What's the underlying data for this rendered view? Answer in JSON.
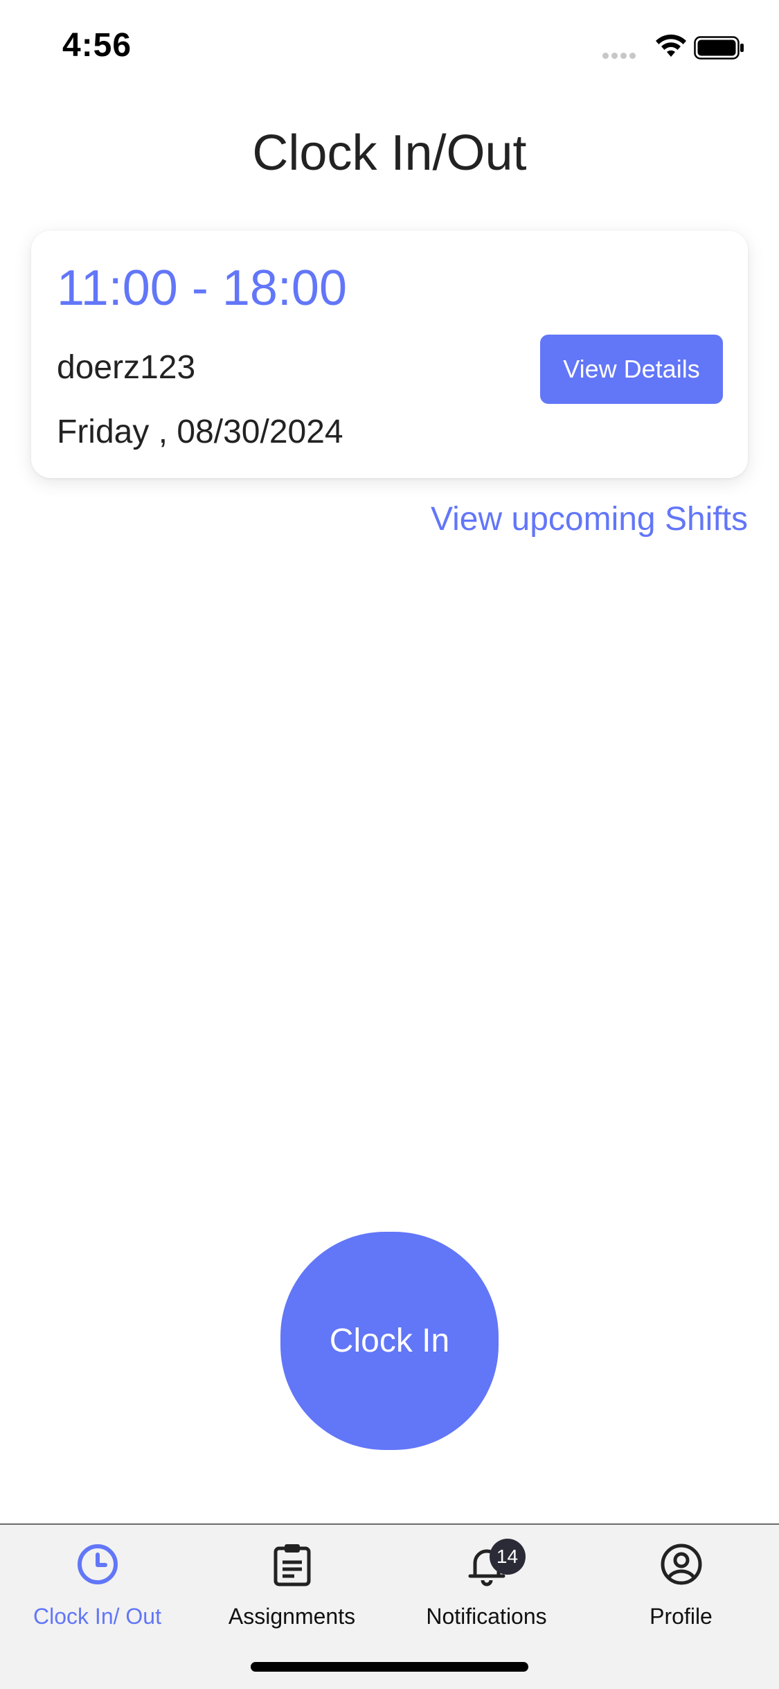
{
  "status_bar": {
    "time": "4:56"
  },
  "header": {
    "title": "Clock In/Out"
  },
  "shift_card": {
    "time_range": "11:00 - 18:00",
    "username": "doerz123",
    "date": "Friday , 08/30/2024",
    "view_details_label": "View Details"
  },
  "links": {
    "upcoming_shifts": "View upcoming Shifts"
  },
  "clock_in": {
    "label": "Clock In"
  },
  "tab_bar": {
    "active_tab": "Clock In/ Out",
    "tabs": [
      {
        "label": "Clock In/ Out",
        "icon": "clock-icon"
      },
      {
        "label": "Assignments",
        "icon": "clipboard-icon"
      },
      {
        "label": "Notifications",
        "icon": "bell-icon",
        "badge": "14"
      },
      {
        "label": "Profile",
        "icon": "user-circle-icon"
      }
    ]
  },
  "colors": {
    "accent": "#6276f8",
    "text": "#222222",
    "tab_bar_bg": "#f2f2f2",
    "badge_bg": "#2b2b38"
  }
}
